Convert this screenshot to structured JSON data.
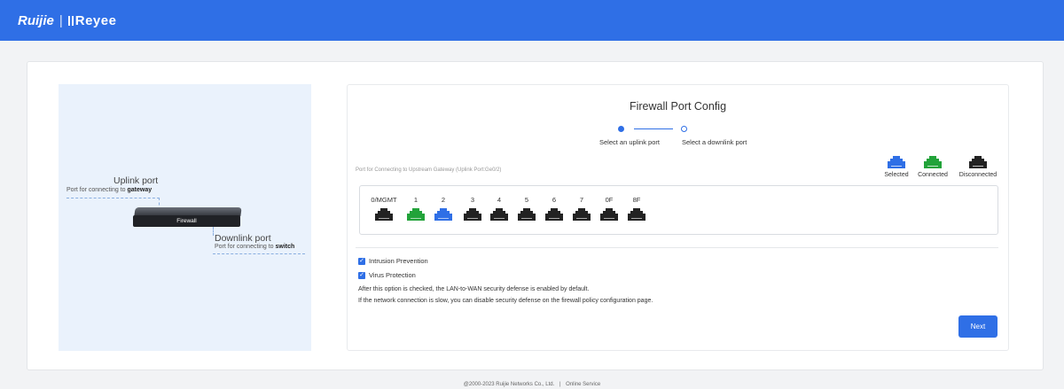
{
  "header": {
    "brand_primary": "Ruijie",
    "brand_separator": "|",
    "brand_secondary": "Reyee",
    "bg_color": "#2f6fe6"
  },
  "illustration": {
    "uplink_title": "Uplink port",
    "uplink_sub_prefix": "Port for connecting to ",
    "uplink_sub_bold": "gateway",
    "device_label": "Firewall",
    "downlink_title": "Downlink port",
    "downlink_sub_prefix": "Port for connecting to ",
    "downlink_sub_bold": "switch"
  },
  "panel": {
    "title": "Firewall Port Config",
    "steps": [
      {
        "label": "Select an uplink port",
        "state": "active"
      },
      {
        "label": "Select a downlink port",
        "state": "pending"
      }
    ],
    "uplink_info": "Port for Connecting to Upstream Gateway (Uplink Port:Ge0/2)",
    "legend": [
      {
        "label": "Selected",
        "color": "#2f6fe6",
        "icon": "ethernet-port-icon"
      },
      {
        "label": "Connected",
        "color": "#22a33a",
        "icon": "ethernet-port-icon"
      },
      {
        "label": "Disconnected",
        "color": "#222222",
        "icon": "ethernet-port-icon"
      }
    ],
    "ports": [
      {
        "name": "0/MGMT",
        "status": "disconnected"
      },
      {
        "name": "1",
        "status": "connected"
      },
      {
        "name": "2",
        "status": "selected"
      },
      {
        "name": "3",
        "status": "disconnected"
      },
      {
        "name": "4",
        "status": "disconnected"
      },
      {
        "name": "5",
        "status": "disconnected"
      },
      {
        "name": "6",
        "status": "disconnected"
      },
      {
        "name": "7",
        "status": "disconnected"
      },
      {
        "name": "0F",
        "status": "disconnected"
      },
      {
        "name": "8F",
        "status": "disconnected"
      }
    ],
    "options": [
      {
        "label": "Intrusion Prevention",
        "checked": true
      },
      {
        "label": "Virus Protection",
        "checked": true
      }
    ],
    "notes": [
      "After this option is checked, the LAN-to-WAN security defense is enabled by default.",
      "If the network connection is slow, you can disable security defense on the firewall policy configuration page."
    ],
    "next_label": "Next"
  },
  "footer": {
    "copyright": "@2000-2023 Ruijie Networks Co., Ltd.",
    "separator": "|",
    "link": "Online Service"
  }
}
